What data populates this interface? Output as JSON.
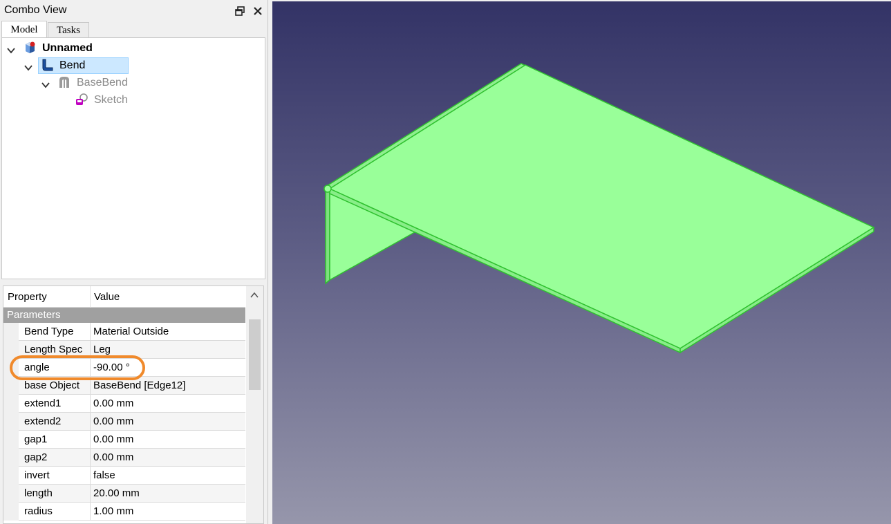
{
  "panel": {
    "title": "Combo View",
    "float_icon": "float-window-icon",
    "close_icon": "close-icon"
  },
  "tabs": [
    {
      "label": "Model",
      "active": true
    },
    {
      "label": "Tasks",
      "active": false
    }
  ],
  "tree": {
    "document": {
      "label": "Unnamed",
      "icon": "document-icon"
    },
    "bend": {
      "label": "Bend",
      "icon": "bend-icon",
      "selected": true
    },
    "basebend": {
      "label": "BaseBend",
      "icon": "basebend-icon"
    },
    "sketch": {
      "label": "Sketch",
      "icon": "sketch-icon"
    }
  },
  "properties": {
    "header": {
      "property": "Property",
      "value": "Value"
    },
    "group": "Parameters",
    "rows": [
      {
        "name": "Bend Type",
        "value": "Material Outside"
      },
      {
        "name": "Length Spec",
        "value": "Leg"
      },
      {
        "name": "angle",
        "value": "-90.00 °"
      },
      {
        "name": "base Object",
        "value": "BaseBend [Edge12]"
      },
      {
        "name": "extend1",
        "value": "0.00 mm"
      },
      {
        "name": "extend2",
        "value": "0.00 mm"
      },
      {
        "name": "gap1",
        "value": "0.00 mm"
      },
      {
        "name": "gap2",
        "value": "0.00 mm"
      },
      {
        "name": "invert",
        "value": "false"
      },
      {
        "name": "length",
        "value": "20.00 mm"
      },
      {
        "name": "radius",
        "value": "1.00 mm"
      }
    ],
    "highlighted_row": "angle",
    "highlight_color": "#f08a2c"
  },
  "viewport": {
    "model_fill": "#99ff99",
    "model_edge": "#33cc33",
    "background_top": "#333366",
    "background_bottom": "#9696ab"
  }
}
